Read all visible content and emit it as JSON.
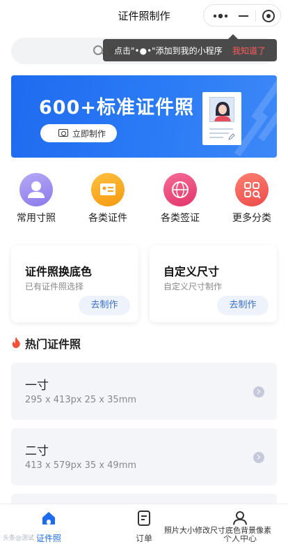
{
  "navbar": {
    "title": "证件照制作"
  },
  "search": {
    "placeholder": "搜"
  },
  "tooltip": {
    "text": "点击\"•●•\"添加到我的小程序",
    "dismiss": "我知道了"
  },
  "banner": {
    "title": "600+标准证件照",
    "button_label": "立即制作"
  },
  "categories": [
    {
      "label": "常用寸照",
      "icon": "person-icon",
      "color": "#9d8ff0"
    },
    {
      "label": "各类证件",
      "icon": "id-card-icon",
      "color": "#f7a21b"
    },
    {
      "label": "各类签证",
      "icon": "globe-icon",
      "color": "#e8467a"
    },
    {
      "label": "更多分类",
      "icon": "grid-icon",
      "color": "#f05a5a"
    }
  ],
  "cards": [
    {
      "title": "证件照换底色",
      "subtitle": "已有证件照选择",
      "button": "去制作"
    },
    {
      "title": "自定义尺寸",
      "subtitle": "自定义尺寸制作",
      "button": "去制作"
    }
  ],
  "hot": {
    "title": "热门证件照",
    "items": [
      {
        "name": "一寸",
        "spec": "295 x 413px  25 x 35mm"
      },
      {
        "name": "二寸",
        "spec": "413 x 579px  35 x 49mm"
      }
    ]
  },
  "tabbar": [
    {
      "label": "证件照",
      "active": true
    },
    {
      "label": "订单",
      "active": false
    },
    {
      "label": "个人中心",
      "active": false
    }
  ],
  "watermark": {
    "left": "头条@测试",
    "right": "照片大小修改尺寸底色背景像素"
  },
  "colors": {
    "accent": "#1f6bf0",
    "tooltip_dismiss": "#ff5a5a"
  }
}
